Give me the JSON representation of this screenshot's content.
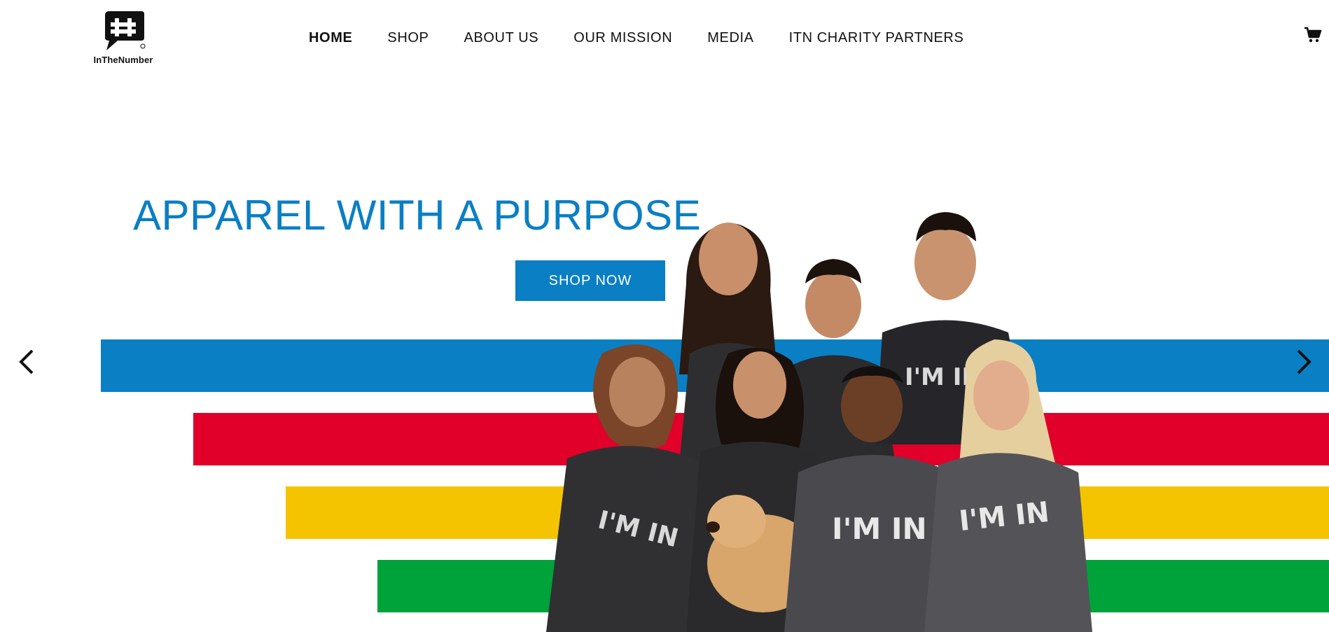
{
  "brand": {
    "name": "InTheNumber"
  },
  "nav": {
    "items": [
      {
        "label": "HOME",
        "active": true
      },
      {
        "label": "SHOP",
        "active": false
      },
      {
        "label": "ABOUT US",
        "active": false
      },
      {
        "label": "OUR MISSION",
        "active": false
      },
      {
        "label": "MEDIA",
        "active": false
      },
      {
        "label": "ITN CHARITY PARTNERS",
        "active": false
      }
    ]
  },
  "cart": {
    "icon": "cart-icon"
  },
  "hero": {
    "headline": "APPAREL WITH A PURPOSE",
    "cta_label": "SHOP NOW",
    "shirt_print": "I'M IN",
    "stripes": [
      "blue",
      "red",
      "yellow",
      "green"
    ]
  },
  "carousel": {
    "prev_icon": "chevron-left-icon",
    "next_icon": "chevron-right-icon"
  },
  "colors": {
    "accent": "#0a7fc4",
    "stripe_blue": "#0a7fc4",
    "stripe_red": "#e0002a",
    "stripe_yellow": "#f4c400",
    "stripe_green": "#00a23a",
    "text_dark": "#111111"
  }
}
